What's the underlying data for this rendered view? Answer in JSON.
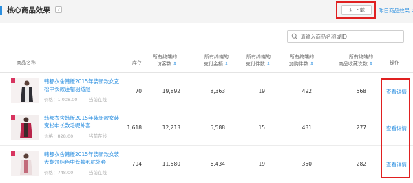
{
  "header": {
    "title": "核心商品效果",
    "help_label": "?",
    "download_label": "下载",
    "yesterday_link": "昨日商品效果 >"
  },
  "search": {
    "placeholder": "请输入商品名称或ID"
  },
  "columns": [
    {
      "line1": "",
      "line2": "商品名称"
    },
    {
      "line1": "",
      "line2": "库存"
    },
    {
      "line1": "所有终端的",
      "line2": "访客数"
    },
    {
      "line1": "所有终端的",
      "line2": "支付金额"
    },
    {
      "line1": "所有终端的",
      "line2": "支付件数"
    },
    {
      "line1": "所有终端的",
      "line2": "加购件数"
    },
    {
      "line1": "所有终端的",
      "line2": "商品收藏次数"
    },
    {
      "line1": "",
      "line2": "操作"
    }
  ],
  "rows": [
    {
      "name": "韩都衣舍韩版2015年装新款女宽松中长款连帽羽绒服",
      "price": "价格：1,008.00",
      "status": "当前在线",
      "stock": "70",
      "visitors": "19,892",
      "amount": "8,363",
      "pay_qty": "19",
      "cart_qty": "492",
      "favorites": "568",
      "action": "查看详情"
    },
    {
      "name": "韩都衣舍韩版2015年装新款女装宽松中长款毛呢外套",
      "price": "价格：828.00",
      "status": "当前在线",
      "stock": "1,618",
      "visitors": "12,213",
      "amount": "5,588",
      "pay_qty": "15",
      "cart_qty": "431",
      "favorites": "277",
      "action": "查看详情"
    },
    {
      "name": "韩都衣舍韩版2015年装新款女装大翻领纯色中长款毛呢外套",
      "price": "价格：748.00",
      "status": "当前在线",
      "stock": "794",
      "visitors": "11,580",
      "amount": "6,434",
      "pay_qty": "19",
      "cart_qty": "350",
      "favorites": "282",
      "action": "查看详情"
    }
  ],
  "colors": {
    "accent": "#2b8fe0",
    "highlight": "#e02020"
  }
}
